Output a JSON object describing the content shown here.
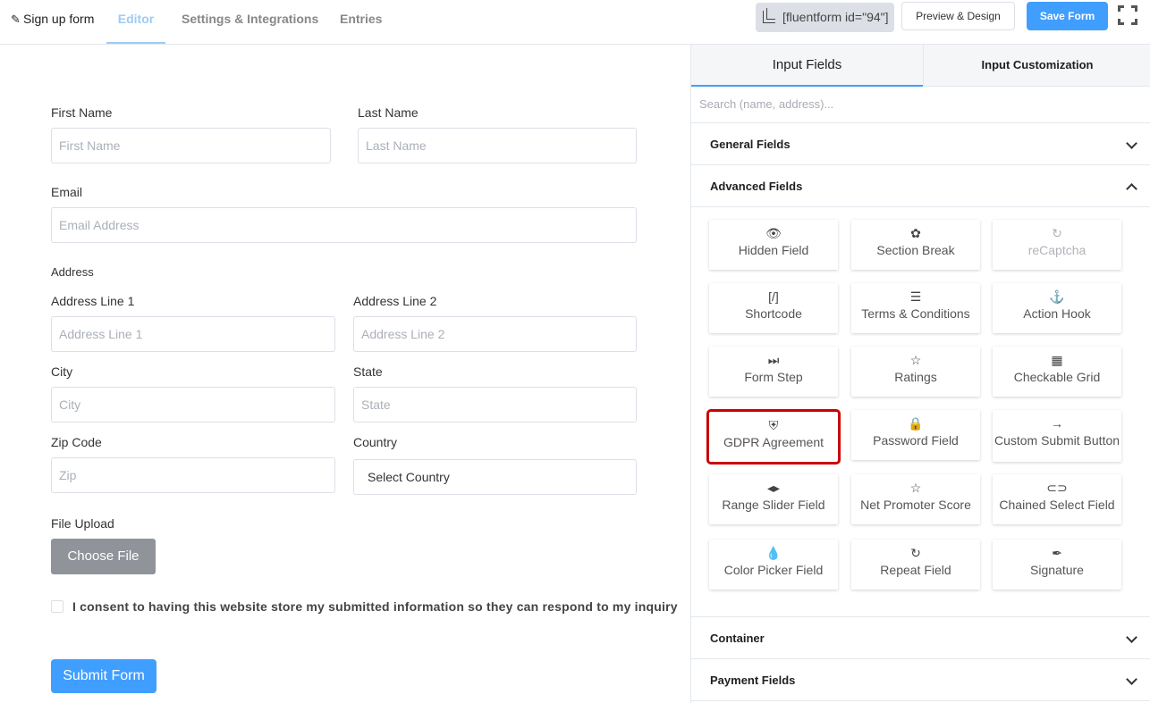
{
  "topbar": {
    "form_name": "Sign up form",
    "tabs": [
      "Editor",
      "Settings & Integrations",
      "Entries"
    ],
    "active_tab": "Editor",
    "shortcode": "[fluentform id=\"94\"]",
    "preview_label": "Preview & Design",
    "save_label": "Save Form"
  },
  "form": {
    "first_name": {
      "label": "First Name",
      "placeholder": "First Name"
    },
    "last_name": {
      "label": "Last Name",
      "placeholder": "Last Name"
    },
    "email": {
      "label": "Email",
      "placeholder": "Email Address"
    },
    "address_heading": "Address",
    "address1": {
      "label": "Address Line 1",
      "placeholder": "Address Line 1"
    },
    "address2": {
      "label": "Address Line 2",
      "placeholder": "Address Line 2"
    },
    "city": {
      "label": "City",
      "placeholder": "City"
    },
    "state": {
      "label": "State",
      "placeholder": "State"
    },
    "zip": {
      "label": "Zip Code",
      "placeholder": "Zip"
    },
    "country": {
      "label": "Country",
      "value": "Select Country"
    },
    "file_upload": {
      "label": "File Upload",
      "button": "Choose File"
    },
    "consent": "I consent to having this website store my submitted information so they can respond to my inquiry",
    "submit": "Submit Form"
  },
  "panel": {
    "tabs": {
      "input": "Input Fields",
      "custom": "Input Customization"
    },
    "search_placeholder": "Search (name, address)...",
    "sections": {
      "general": "General Fields",
      "advanced": "Advanced Fields",
      "container": "Container",
      "payment": "Payment Fields"
    },
    "fields": [
      {
        "label": "Hidden Field",
        "icon": "👁"
      },
      {
        "label": "Section Break",
        "icon": "✿"
      },
      {
        "label": "reCaptcha",
        "icon": "↻"
      },
      {
        "label": "Shortcode",
        "icon": "[/]"
      },
      {
        "label": "Terms & Conditions",
        "icon": "☰"
      },
      {
        "label": "Action Hook",
        "icon": "⚓"
      },
      {
        "label": "Form Step",
        "icon": "⏭"
      },
      {
        "label": "Ratings",
        "icon": "☆"
      },
      {
        "label": "Checkable Grid",
        "icon": "▦"
      },
      {
        "label": "GDPR Agreement",
        "icon": "⛨"
      },
      {
        "label": "Password Field",
        "icon": "🔒"
      },
      {
        "label": "Custom Submit Button",
        "icon": "→"
      },
      {
        "label": "Range Slider Field",
        "icon": "◂▸"
      },
      {
        "label": "Net Promoter Score",
        "icon": "☆"
      },
      {
        "label": "Chained Select Field",
        "icon": "⊂⊃"
      },
      {
        "label": "Color Picker Field",
        "icon": "💧"
      },
      {
        "label": "Repeat Field",
        "icon": "↻"
      },
      {
        "label": "Signature",
        "icon": "✒"
      }
    ],
    "highlighted_field": "GDPR Agreement",
    "disabled_field": "reCaptcha"
  },
  "colors": {
    "primary": "#409eff",
    "active_tab": "#9fcbf4",
    "highlight": "#cc0000",
    "choose_file_bg": "#909399"
  }
}
